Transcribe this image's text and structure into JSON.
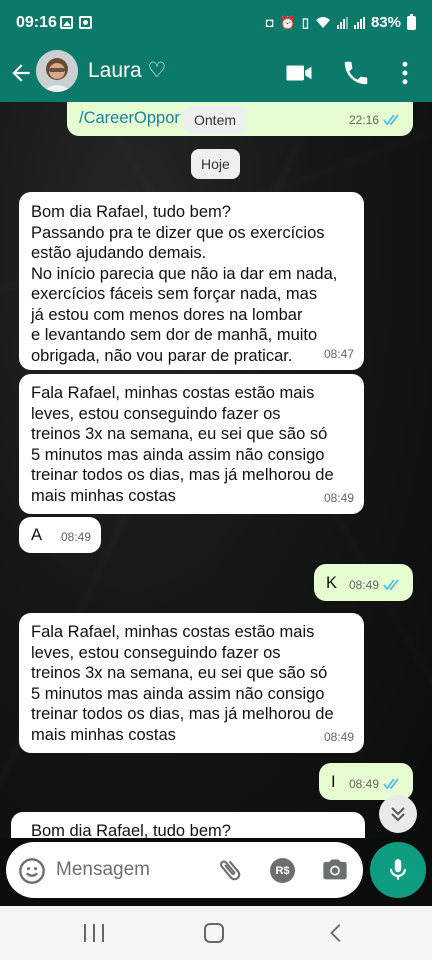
{
  "status_bar": {
    "time": "09:16",
    "battery": "83%",
    "left_icons": [
      "image-notification-icon",
      "screen-record-icon"
    ],
    "right_icons": [
      "nfc-icon",
      "alarm-icon",
      "vibrate-icon",
      "wifi-icon",
      "signal-icon",
      "signal-icon",
      "battery-icon"
    ]
  },
  "header": {
    "contact_name": "Laura ♡",
    "icons": [
      "back-arrow-icon",
      "video-call-icon",
      "phone-call-icon",
      "more-options-icon"
    ],
    "accent_color": "#0b7a6a"
  },
  "chat": {
    "previous_message": {
      "link_text": "/CareerOppor",
      "time": "22:16",
      "status": "read"
    },
    "date_separators": [
      "Ontem",
      "Hoje"
    ],
    "messages": [
      {
        "direction": "in",
        "text": "Bom dia Rafael, tudo bem?\nPassando pra te dizer que os exercícios\nestão ajudando demais.\nNo início parecia que não ia dar em nada,\nexercícios fáceis sem forçar nada, mas\njá estou com menos dores na lombar\ne levantando sem dor de manhã, muito\nobrigada, não vou parar de praticar.",
        "time": "08:47"
      },
      {
        "direction": "in",
        "text": "Fala Rafael, minhas costas estão mais\nleves, estou conseguindo fazer os\ntreinos 3x na semana, eu sei que são só\n5 minutos mas ainda assim não consigo\ntreinar todos os dias, mas já melhorou de\nmais minhas costas",
        "time": "08:49"
      },
      {
        "direction": "in",
        "text": "A",
        "time": "08:49"
      },
      {
        "direction": "out",
        "text": "K",
        "time": "08:49",
        "status": "read"
      },
      {
        "direction": "in",
        "text": "Fala Rafael, minhas costas estão mais\nleves, estou conseguindo fazer os\ntreinos 3x na semana, eu sei que são só\n5 minutos mas ainda assim não consigo\ntreinar todos os dias, mas já melhorou de\nmais minhas costas",
        "time": "08:49"
      },
      {
        "direction": "out",
        "text": "I",
        "time": "08:49",
        "status": "read"
      },
      {
        "direction": "in",
        "text": "Bom dia Rafael, tudo bem?",
        "time": ""
      }
    ]
  },
  "composer": {
    "placeholder": "Mensagem",
    "payment_label": "R$",
    "icons": [
      "emoji-icon",
      "attach-icon",
      "payment-icon",
      "camera-icon",
      "microphone-icon"
    ]
  },
  "scroll_down_icon": "chevron-double-down-icon",
  "nav_bar": {
    "icons": [
      "recent-apps-icon",
      "home-icon",
      "back-icon"
    ]
  },
  "colors": {
    "incoming_bubble": "#ffffff",
    "outgoing_bubble": "#e6fdd2",
    "read_ticks": "#53bdeb",
    "mic_button": "#0e9d80"
  }
}
